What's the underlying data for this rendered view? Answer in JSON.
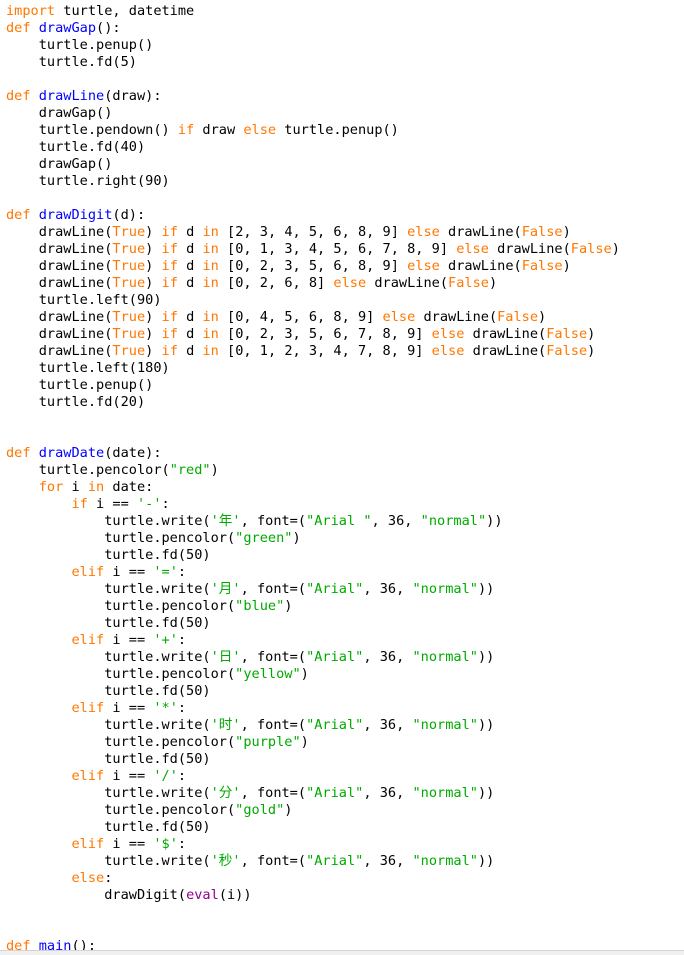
{
  "editor": {
    "colors": {
      "keyword": "#ff7700",
      "definition": "#0000ff",
      "string": "#00aa00",
      "builtin": "#900090",
      "text": "#000000",
      "background": "#ffffff"
    },
    "lines": [
      [
        [
          "kw",
          "import"
        ],
        [
          "p",
          " turtle, datetime"
        ]
      ],
      [
        [
          "kw",
          "def"
        ],
        [
          "p",
          " "
        ],
        [
          "def",
          "drawGap"
        ],
        [
          "p",
          "():"
        ]
      ],
      [
        [
          "p",
          "    turtle.penup()"
        ]
      ],
      [
        [
          "p",
          "    turtle.fd(5)"
        ]
      ],
      [],
      [
        [
          "kw",
          "def"
        ],
        [
          "p",
          " "
        ],
        [
          "def",
          "drawLine"
        ],
        [
          "p",
          "(draw):"
        ]
      ],
      [
        [
          "p",
          "    drawGap()"
        ]
      ],
      [
        [
          "p",
          "    turtle.pendown() "
        ],
        [
          "kw",
          "if"
        ],
        [
          "p",
          " draw "
        ],
        [
          "kw",
          "else"
        ],
        [
          "p",
          " turtle.penup()"
        ]
      ],
      [
        [
          "p",
          "    turtle.fd(40)"
        ]
      ],
      [
        [
          "p",
          "    drawGap()"
        ]
      ],
      [
        [
          "p",
          "    turtle.right(90)"
        ]
      ],
      [],
      [
        [
          "kw",
          "def"
        ],
        [
          "p",
          " "
        ],
        [
          "def",
          "drawDigit"
        ],
        [
          "p",
          "(d):"
        ]
      ],
      [
        [
          "p",
          "    drawLine("
        ],
        [
          "kw",
          "True"
        ],
        [
          "p",
          ") "
        ],
        [
          "kw",
          "if"
        ],
        [
          "p",
          " d "
        ],
        [
          "kw",
          "in"
        ],
        [
          "p",
          " [2, 3, 4, 5, 6, 8, 9] "
        ],
        [
          "kw",
          "else"
        ],
        [
          "p",
          " drawLine("
        ],
        [
          "kw",
          "False"
        ],
        [
          "p",
          ")"
        ]
      ],
      [
        [
          "p",
          "    drawLine("
        ],
        [
          "kw",
          "True"
        ],
        [
          "p",
          ") "
        ],
        [
          "kw",
          "if"
        ],
        [
          "p",
          " d "
        ],
        [
          "kw",
          "in"
        ],
        [
          "p",
          " [0, 1, 3, 4, 5, 6, 7, 8, 9] "
        ],
        [
          "kw",
          "else"
        ],
        [
          "p",
          " drawLine("
        ],
        [
          "kw",
          "False"
        ],
        [
          "p",
          ")"
        ]
      ],
      [
        [
          "p",
          "    drawLine("
        ],
        [
          "kw",
          "True"
        ],
        [
          "p",
          ") "
        ],
        [
          "kw",
          "if"
        ],
        [
          "p",
          " d "
        ],
        [
          "kw",
          "in"
        ],
        [
          "p",
          " [0, 2, 3, 5, 6, 8, 9] "
        ],
        [
          "kw",
          "else"
        ],
        [
          "p",
          " drawLine("
        ],
        [
          "kw",
          "False"
        ],
        [
          "p",
          ")"
        ]
      ],
      [
        [
          "p",
          "    drawLine("
        ],
        [
          "kw",
          "True"
        ],
        [
          "p",
          ") "
        ],
        [
          "kw",
          "if"
        ],
        [
          "p",
          " d "
        ],
        [
          "kw",
          "in"
        ],
        [
          "p",
          " [0, 2, 6, 8] "
        ],
        [
          "kw",
          "else"
        ],
        [
          "p",
          " drawLine("
        ],
        [
          "kw",
          "False"
        ],
        [
          "p",
          ")"
        ]
      ],
      [
        [
          "p",
          "    turtle.left(90)"
        ]
      ],
      [
        [
          "p",
          "    drawLine("
        ],
        [
          "kw",
          "True"
        ],
        [
          "p",
          ") "
        ],
        [
          "kw",
          "if"
        ],
        [
          "p",
          " d "
        ],
        [
          "kw",
          "in"
        ],
        [
          "p",
          " [0, 4, 5, 6, 8, 9] "
        ],
        [
          "kw",
          "else"
        ],
        [
          "p",
          " drawLine("
        ],
        [
          "kw",
          "False"
        ],
        [
          "p",
          ")"
        ]
      ],
      [
        [
          "p",
          "    drawLine("
        ],
        [
          "kw",
          "True"
        ],
        [
          "p",
          ") "
        ],
        [
          "kw",
          "if"
        ],
        [
          "p",
          " d "
        ],
        [
          "kw",
          "in"
        ],
        [
          "p",
          " [0, 2, 3, 5, 6, 7, 8, 9] "
        ],
        [
          "kw",
          "else"
        ],
        [
          "p",
          " drawLine("
        ],
        [
          "kw",
          "False"
        ],
        [
          "p",
          ")"
        ]
      ],
      [
        [
          "p",
          "    drawLine("
        ],
        [
          "kw",
          "True"
        ],
        [
          "p",
          ") "
        ],
        [
          "kw",
          "if"
        ],
        [
          "p",
          " d "
        ],
        [
          "kw",
          "in"
        ],
        [
          "p",
          " [0, 1, 2, 3, 4, 7, 8, 9] "
        ],
        [
          "kw",
          "else"
        ],
        [
          "p",
          " drawLine("
        ],
        [
          "kw",
          "False"
        ],
        [
          "p",
          ")"
        ]
      ],
      [
        [
          "p",
          "    turtle.left(180)"
        ]
      ],
      [
        [
          "p",
          "    turtle.penup()"
        ]
      ],
      [
        [
          "p",
          "    turtle.fd(20)"
        ]
      ],
      [],
      [],
      [
        [
          "kw",
          "def"
        ],
        [
          "p",
          " "
        ],
        [
          "def",
          "drawDate"
        ],
        [
          "p",
          "(date):"
        ]
      ],
      [
        [
          "p",
          "    turtle.pencolor("
        ],
        [
          "str",
          "\"red\""
        ],
        [
          "p",
          ")"
        ]
      ],
      [
        [
          "p",
          "    "
        ],
        [
          "kw",
          "for"
        ],
        [
          "p",
          " i "
        ],
        [
          "kw",
          "in"
        ],
        [
          "p",
          " date:"
        ]
      ],
      [
        [
          "p",
          "        "
        ],
        [
          "kw",
          "if"
        ],
        [
          "p",
          " i == "
        ],
        [
          "str",
          "'-'"
        ],
        [
          "p",
          ":"
        ]
      ],
      [
        [
          "p",
          "            turtle.write("
        ],
        [
          "str",
          "'年'"
        ],
        [
          "p",
          ", font=("
        ],
        [
          "str",
          "\"Arial \""
        ],
        [
          "p",
          ", 36, "
        ],
        [
          "str",
          "\"normal\""
        ],
        [
          "p",
          "))"
        ]
      ],
      [
        [
          "p",
          "            turtle.pencolor("
        ],
        [
          "str",
          "\"green\""
        ],
        [
          "p",
          ")"
        ]
      ],
      [
        [
          "p",
          "            turtle.fd(50)"
        ]
      ],
      [
        [
          "p",
          "        "
        ],
        [
          "kw",
          "elif"
        ],
        [
          "p",
          " i == "
        ],
        [
          "str",
          "'='"
        ],
        [
          "p",
          ":"
        ]
      ],
      [
        [
          "p",
          "            turtle.write("
        ],
        [
          "str",
          "'月'"
        ],
        [
          "p",
          ", font=("
        ],
        [
          "str",
          "\"Arial\""
        ],
        [
          "p",
          ", 36, "
        ],
        [
          "str",
          "\"normal\""
        ],
        [
          "p",
          "))"
        ]
      ],
      [
        [
          "p",
          "            turtle.pencolor("
        ],
        [
          "str",
          "\"blue\""
        ],
        [
          "p",
          ")"
        ]
      ],
      [
        [
          "p",
          "            turtle.fd(50)"
        ]
      ],
      [
        [
          "p",
          "        "
        ],
        [
          "kw",
          "elif"
        ],
        [
          "p",
          " i == "
        ],
        [
          "str",
          "'+'"
        ],
        [
          "p",
          ":"
        ]
      ],
      [
        [
          "p",
          "            turtle.write("
        ],
        [
          "str",
          "'日'"
        ],
        [
          "p",
          ", font=("
        ],
        [
          "str",
          "\"Arial\""
        ],
        [
          "p",
          ", 36, "
        ],
        [
          "str",
          "\"normal\""
        ],
        [
          "p",
          "))"
        ]
      ],
      [
        [
          "p",
          "            turtle.pencolor("
        ],
        [
          "str",
          "\"yellow\""
        ],
        [
          "p",
          ")"
        ]
      ],
      [
        [
          "p",
          "            turtle.fd(50)"
        ]
      ],
      [
        [
          "p",
          "        "
        ],
        [
          "kw",
          "elif"
        ],
        [
          "p",
          " i == "
        ],
        [
          "str",
          "'*'"
        ],
        [
          "p",
          ":"
        ]
      ],
      [
        [
          "p",
          "            turtle.write("
        ],
        [
          "str",
          "'时'"
        ],
        [
          "p",
          ", font=("
        ],
        [
          "str",
          "\"Arial\""
        ],
        [
          "p",
          ", 36, "
        ],
        [
          "str",
          "\"normal\""
        ],
        [
          "p",
          "))"
        ]
      ],
      [
        [
          "p",
          "            turtle.pencolor("
        ],
        [
          "str",
          "\"purple\""
        ],
        [
          "p",
          ")"
        ]
      ],
      [
        [
          "p",
          "            turtle.fd(50)"
        ]
      ],
      [
        [
          "p",
          "        "
        ],
        [
          "kw",
          "elif"
        ],
        [
          "p",
          " i == "
        ],
        [
          "str",
          "'/'"
        ],
        [
          "p",
          ":"
        ]
      ],
      [
        [
          "p",
          "            turtle.write("
        ],
        [
          "str",
          "'分'"
        ],
        [
          "p",
          ", font=("
        ],
        [
          "str",
          "\"Arial\""
        ],
        [
          "p",
          ", 36, "
        ],
        [
          "str",
          "\"normal\""
        ],
        [
          "p",
          "))"
        ]
      ],
      [
        [
          "p",
          "            turtle.pencolor("
        ],
        [
          "str",
          "\"gold\""
        ],
        [
          "p",
          ")"
        ]
      ],
      [
        [
          "p",
          "            turtle.fd(50)"
        ]
      ],
      [
        [
          "p",
          "        "
        ],
        [
          "kw",
          "elif"
        ],
        [
          "p",
          " i == "
        ],
        [
          "str",
          "'$'"
        ],
        [
          "p",
          ":"
        ]
      ],
      [
        [
          "p",
          "            turtle.write("
        ],
        [
          "str",
          "'秒'"
        ],
        [
          "p",
          ", font=("
        ],
        [
          "str",
          "\"Arial\""
        ],
        [
          "p",
          ", 36, "
        ],
        [
          "str",
          "\"normal\""
        ],
        [
          "p",
          "))"
        ]
      ],
      [
        [
          "p",
          "        "
        ],
        [
          "kw",
          "else"
        ],
        [
          "p",
          ":"
        ]
      ],
      [
        [
          "p",
          "            drawDigit("
        ],
        [
          "builtin",
          "eval"
        ],
        [
          "p",
          "(i))"
        ]
      ],
      [],
      [],
      [
        [
          "kw",
          "def"
        ],
        [
          "p",
          " "
        ],
        [
          "def",
          "main"
        ],
        [
          "p",
          "():"
        ]
      ]
    ]
  }
}
